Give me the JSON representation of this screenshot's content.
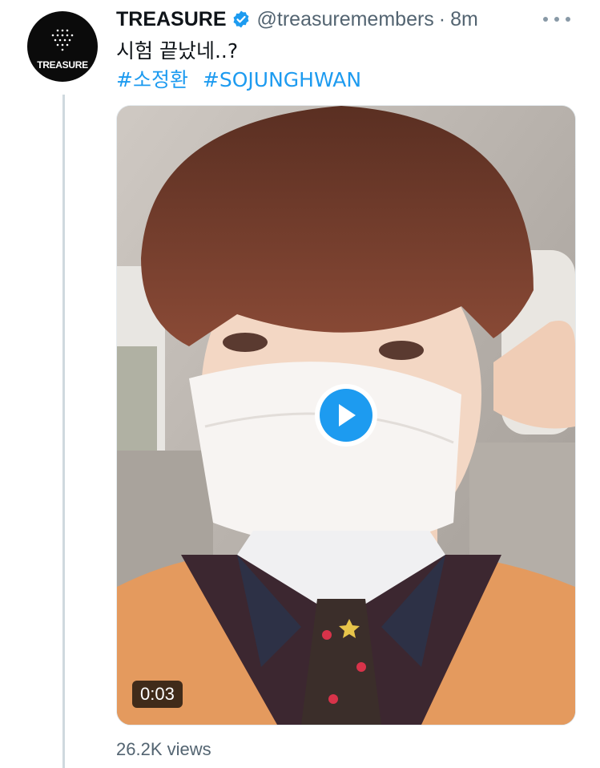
{
  "tweet": {
    "author_name": "TREASURE",
    "verified": true,
    "handle": "@treasuremembers",
    "separator": "·",
    "time": "8m",
    "avatar_logo_text": "TREASURE",
    "text": "시험 끝났네..?",
    "hashtags": [
      "#소정환",
      "#SOJUNGHWAN"
    ],
    "media": {
      "type": "video",
      "duration": "0:03",
      "play_icon": "play-icon"
    },
    "views": "26.2K views"
  },
  "icons": {
    "verified": "verified-badge-icon",
    "more": "more-options-icon"
  },
  "colors": {
    "link": "#1d9bf0",
    "secondary_text": "#536471",
    "verified": "#1d9bf0",
    "thread_line": "#cfd9de"
  }
}
